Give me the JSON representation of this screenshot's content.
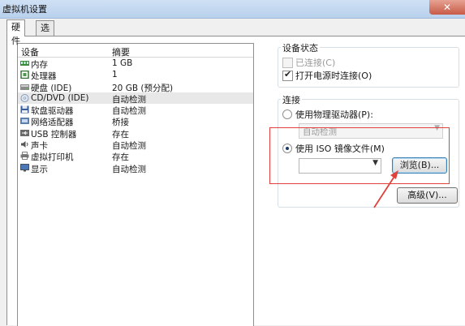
{
  "window": {
    "title": "虚拟机设置",
    "close_symbol": "✕"
  },
  "tabs": [
    {
      "label": "硬件"
    },
    {
      "label": "选项"
    }
  ],
  "devices": {
    "header": {
      "device": "设备",
      "summary": "摘要"
    },
    "rows": [
      {
        "name": "内存",
        "summary": "1 GB",
        "icon": "memory-icon"
      },
      {
        "name": "处理器",
        "summary": "1",
        "icon": "processor-icon"
      },
      {
        "name": "硬盘 (IDE)",
        "summary": "20 GB (预分配)",
        "icon": "harddisk-icon"
      },
      {
        "name": "CD/DVD (IDE)",
        "summary": "自动检测",
        "icon": "cd-dvd-icon",
        "selected": true
      },
      {
        "name": "软盘驱动器",
        "summary": "自动检测",
        "icon": "floppy-icon"
      },
      {
        "name": "网络适配器",
        "summary": "桥接",
        "icon": "network-icon"
      },
      {
        "name": "USB 控制器",
        "summary": "存在",
        "icon": "usb-icon"
      },
      {
        "name": "声卡",
        "summary": "自动检测",
        "icon": "sound-icon"
      },
      {
        "name": "虚拟打印机",
        "summary": "存在",
        "icon": "printer-icon"
      },
      {
        "name": "显示",
        "summary": "自动检测",
        "icon": "display-icon"
      }
    ]
  },
  "device_status": {
    "title": "设备状态",
    "connected": {
      "label": "已连接(C)",
      "checked": false,
      "disabled": true
    },
    "connect_at_power_on": {
      "label": "打开电源时连接(O)",
      "checked": true
    }
  },
  "connection": {
    "title": "连接",
    "physical": {
      "label": "使用物理驱动器(P):",
      "selected": false
    },
    "physical_value": "自动检测",
    "iso": {
      "label": "使用 ISO 镜像文件(M)",
      "selected": true
    },
    "iso_value": "",
    "browse_label": "浏览(B)...",
    "advanced_label": "高级(V)..."
  },
  "colors": {
    "highlight": "#e0413a",
    "title_bar": "#c4d9f1"
  }
}
